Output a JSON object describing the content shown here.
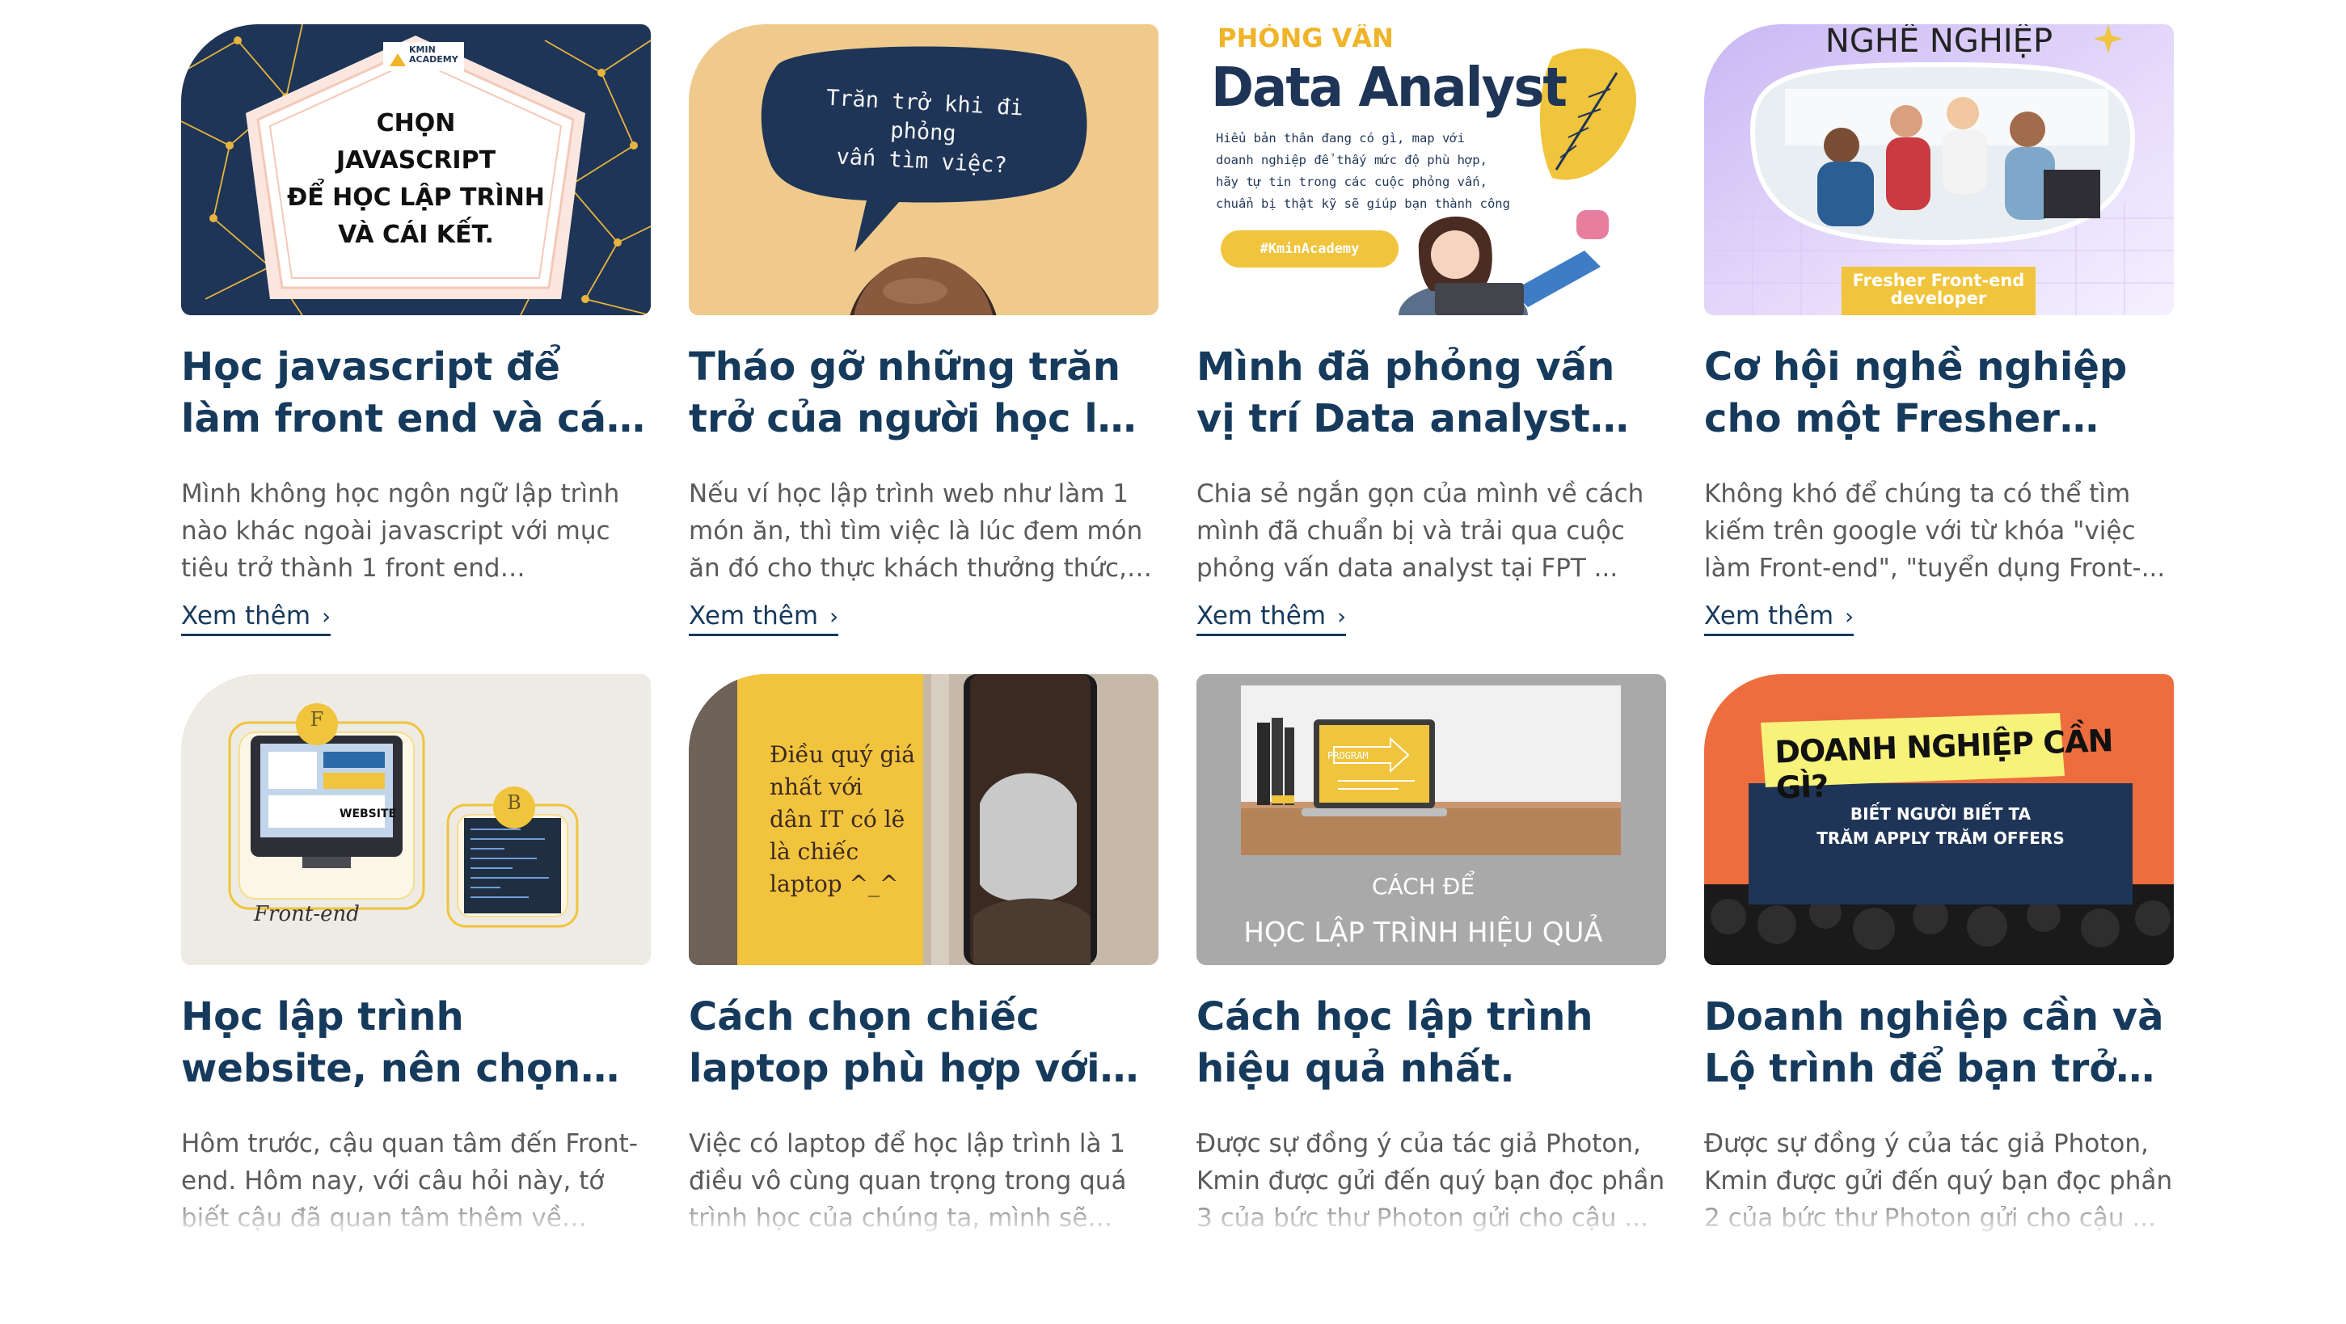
{
  "more_label": "Xem thêm",
  "cards": [
    {
      "title": "Học javascript để làm front end và cái kết.",
      "excerpt": "Mình không học ngôn ngữ lập trình nào khác ngoài javascript với mục tiêu trở thành 1 front end developer...",
      "thumb": {
        "brand_line1": "KMIN",
        "brand_line2": "ACADEMY",
        "lines": [
          "CHỌN",
          "JAVASCRIPT",
          "ĐỂ HỌC LẬP TRÌNH",
          "VÀ CÁI KẾT."
        ]
      }
    },
    {
      "title": "Tháo gỡ những trăn trở của người học lập trình...",
      "excerpt": "Nếu ví học lập trình web như làm 1 món ăn, thì tìm việc là lúc đem món ăn đó cho thực khách thưởng thức, ...",
      "thumb": {
        "lines": [
          "Trăn trở khi đi phỏng",
          "vấn tìm việc?"
        ]
      }
    },
    {
      "title": "Mình đã phỏng vấn vị trí Data analyst như thế nào?",
      "excerpt": "Chia sẻ ngắn gọn của mình về cách mình đã chuẩn bị và trải qua cuộc phỏng vấn data analyst tại FPT ...",
      "thumb": {
        "kicker": "PHỎNG VẤN",
        "heading": "Data Analyst",
        "lines": [
          "Hiểu bản thân đang có gì, map với",
          "doanh nghiệp để thấy mức độ phù hợp,",
          "hãy tự tin trong các cuộc phỏng vấn,",
          "chuẩn bị thật kỹ sẽ giúp bạn thành công"
        ],
        "tag": "#KminAcademy"
      }
    },
    {
      "title": "Cơ hội nghề nghiệp cho một Fresher Front-end developer",
      "excerpt": "Không khó để chúng ta có thể tìm kiếm trên google với từ khóa \"việc làm Front-end\", \"tuyển dụng Front-...",
      "thumb": {
        "heading": "NGHỀ NGHIỆP",
        "banner_line1": "Fresher Front-end",
        "banner_line2": "developer"
      }
    },
    {
      "title": "Học lập trình website, nên chọn Front-end hay Back-end?",
      "excerpt": "Hôm trước, cậu quan tâm đến Front-end. Hôm nay, với câu hỏi này, tớ biết cậu đã quan tâm thêm về Back-...",
      "thumb": {
        "badge_f": "F",
        "badge_b": "B",
        "website_label": "WEBSITE",
        "script": "Front-end"
      }
    },
    {
      "title": "Cách chọn chiếc laptop phù hợp với người học lập trình",
      "excerpt": "Việc có laptop để học lập trình là 1 điều vô cùng quan trọng trong quá trình học của chúng ta, mình sẽ chia...",
      "thumb": {
        "lines": [
          "Điều quý giá",
          "nhất với",
          "dân IT có lẽ",
          "là chiếc",
          "laptop ^_^"
        ]
      }
    },
    {
      "title": "Cách học lập trình hiệu quả nhất.",
      "excerpt": "Được sự đồng ý của tác giả Photon, Kmin được gửi đến quý bạn đọc phần 3 của bức thư Photon gửi cho cậu ...",
      "thumb": {
        "screen_label": "PROGRAM",
        "line1": "CÁCH ĐỂ",
        "line2": "HỌC LẬP TRÌNH HIỆU QUẢ"
      }
    },
    {
      "title": "Doanh nghiệp cần và Lộ trình để bạn trở thành Front-end",
      "excerpt": "Được sự đồng ý của tác giả Photon, Kmin được gửi đến quý bạn đọc phần 2 của bức thư Photon gửi cho cậu ...",
      "thumb": {
        "heading": "DOANH NGHIỆP CẦN GÌ?",
        "line1": "BIẾT NGƯỜI BIẾT TA",
        "line2": "TRĂM APPLY TRĂM OFFERS"
      }
    }
  ],
  "colors": {
    "title": "#163a5c",
    "excerpt": "#5a5a5a",
    "navy": "#1f3557",
    "mustard": "#f0c43c",
    "tan": "#efca8c",
    "orange": "#ee6d3f"
  }
}
